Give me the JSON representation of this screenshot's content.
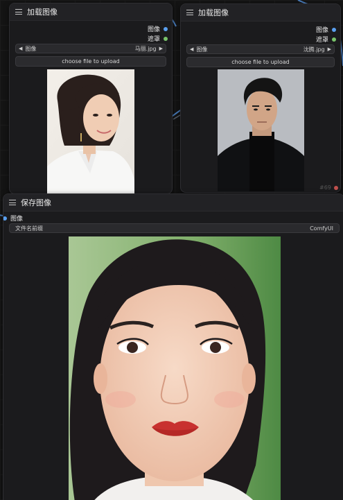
{
  "colors": {
    "image_port": "#5aa0f0",
    "mask_port": "#79c36a",
    "wire": "#4a7fc0",
    "status_dot": "#c0504d"
  },
  "load_node_1": {
    "title": "加载图像",
    "outputs": {
      "image": "图像",
      "mask": "遮罩"
    },
    "combo": {
      "label": "图像",
      "value": "马丽.jpg",
      "left_arrow": "◀",
      "right_arrow": "▶"
    },
    "upload_label": "choose file to upload",
    "menu_icon": "menu-icon"
  },
  "load_node_2": {
    "title": "加载图像",
    "outputs": {
      "image": "图像",
      "mask": "遮罩"
    },
    "combo": {
      "label": "图像",
      "value": "沈腾.jpg",
      "left_arrow": "◀",
      "right_arrow": "▶"
    },
    "upload_label": "choose file to upload",
    "node_id": "#69",
    "menu_icon": "menu-icon"
  },
  "save_node": {
    "title": "保存图像",
    "input": {
      "image": "图像"
    },
    "filename_prefix": {
      "label": "文件名前缀",
      "value": "ComfyUI"
    },
    "menu_icon": "menu-icon"
  }
}
